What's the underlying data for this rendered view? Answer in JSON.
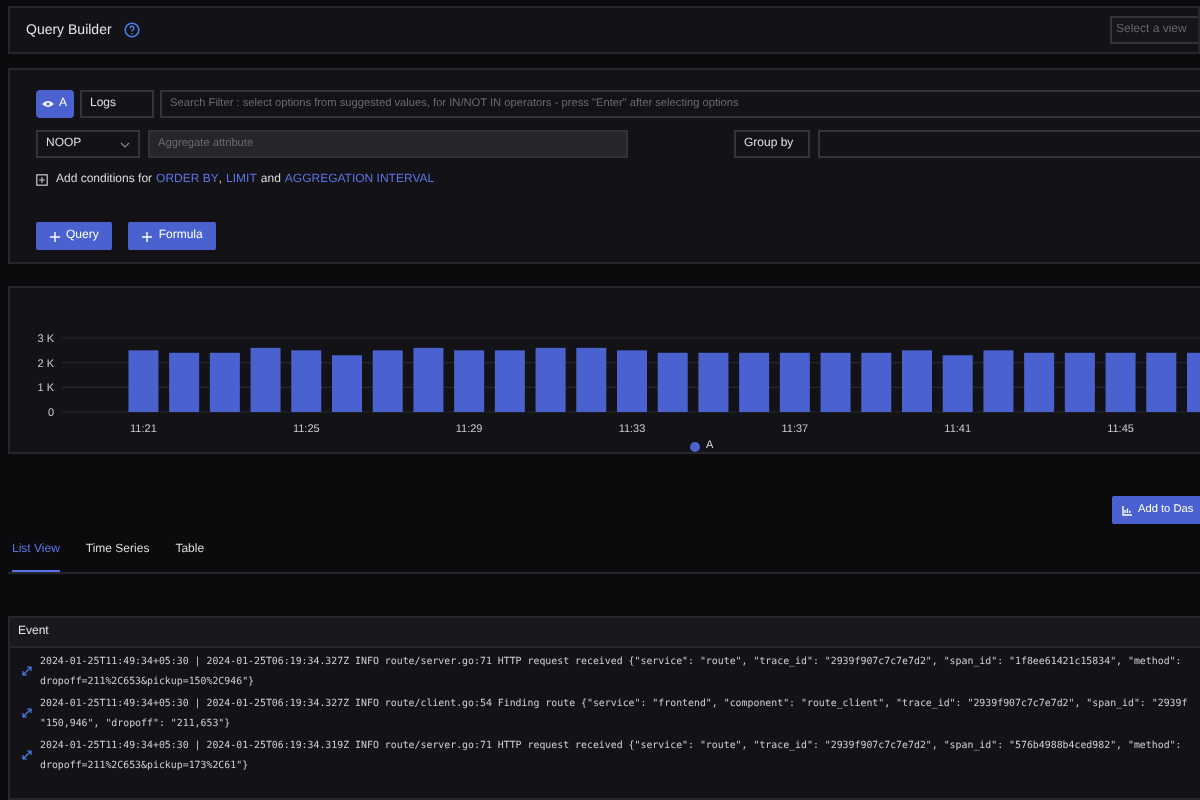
{
  "header": {
    "title": "Query Builder",
    "view_select": {
      "placeholder": "Select a view"
    }
  },
  "query": {
    "toggle_label": "A",
    "visible": true,
    "data_source": "Logs",
    "search": {
      "placeholder": "Search Filter : select options from suggested values, for IN/NOT IN operators - press \"Enter\" after selecting options"
    },
    "aggregate_op": "NOOP",
    "aggregate_attr": {
      "placeholder": "Aggregate attribute"
    },
    "group_by_label": "Group by",
    "conditions": {
      "prefix": "Add conditions for",
      "links": [
        "ORDER BY",
        "LIMIT",
        "AGGREGATION INTERVAL"
      ],
      "joiners": [
        ",",
        "and"
      ]
    },
    "buttons": [
      "Query",
      "Formula"
    ]
  },
  "chart": {
    "chart_data": {
      "type": "bar",
      "x": [
        681,
        682,
        683,
        684,
        685,
        686,
        687,
        688,
        689,
        690,
        691,
        692,
        693,
        694,
        695,
        696,
        697,
        698,
        699,
        700,
        701,
        702,
        703,
        704,
        705,
        706,
        707
      ],
      "series": [
        {
          "name": "A",
          "color": "#4a62d0",
          "values": [
            2500,
            2400,
            2400,
            2600,
            2500,
            2300,
            2500,
            2600,
            2500,
            2500,
            2600,
            2600,
            2500,
            2400,
            2400,
            2400,
            2400,
            2400,
            2400,
            2500,
            2300,
            2500,
            2400,
            2400,
            2400,
            2400,
            2400
          ]
        }
      ],
      "xlim": [
        679,
        707
      ],
      "ylim": [
        0,
        3000
      ],
      "yticks": [
        {
          "value": 0,
          "label": "0"
        },
        {
          "value": 1000,
          "label": "1 K"
        },
        {
          "value": 2000,
          "label": "2 K"
        },
        {
          "value": 3000,
          "label": "3 K"
        }
      ],
      "xticks": [
        {
          "value": 681,
          "label": "11:21"
        },
        {
          "value": 685,
          "label": "11:25"
        },
        {
          "value": 689,
          "label": "11:29"
        },
        {
          "value": 693,
          "label": "11:33"
        },
        {
          "value": 697,
          "label": "11:37"
        },
        {
          "value": 701,
          "label": "11:41"
        },
        {
          "value": 705,
          "label": "11:45"
        }
      ]
    }
  },
  "add_button": "Add to Das",
  "tabs": [
    {
      "label": "List View",
      "selected": true
    },
    {
      "label": "Time Series",
      "selected": false
    },
    {
      "label": "Table",
      "selected": false
    }
  ],
  "table": {
    "column": "Event",
    "rows": [
      {
        "lines": [
          "2024-01-25T11:49:34+05:30 | 2024-01-25T06:19:34.327Z INFO route/server.go:71 HTTP request received {\"service\": \"route\", \"trace_id\": \"2939f907c7c7e7d2\", \"span_id\": \"1f8ee61421c15834\", \"method\":",
          "dropoff=211%2C653&pickup=150%2C946\"}"
        ]
      },
      {
        "lines": [
          "2024-01-25T11:49:34+05:30 | 2024-01-25T06:19:34.327Z INFO route/client.go:54 Finding route {\"service\": \"frontend\", \"component\": \"route_client\", \"trace_id\": \"2939f907c7c7e7d2\", \"span_id\": \"2939f",
          "\"150,946\", \"dropoff\": \"211,653\"}"
        ]
      },
      {
        "lines": [
          "2024-01-25T11:49:34+05:30 | 2024-01-25T06:19:34.319Z INFO route/server.go:71 HTTP request received {\"service\": \"route\", \"trace_id\": \"2939f907c7c7e7d2\", \"span_id\": \"576b4988b4ced982\", \"method\":",
          "dropoff=211%2C653&pickup=173%2C61\"}"
        ]
      }
    ]
  }
}
